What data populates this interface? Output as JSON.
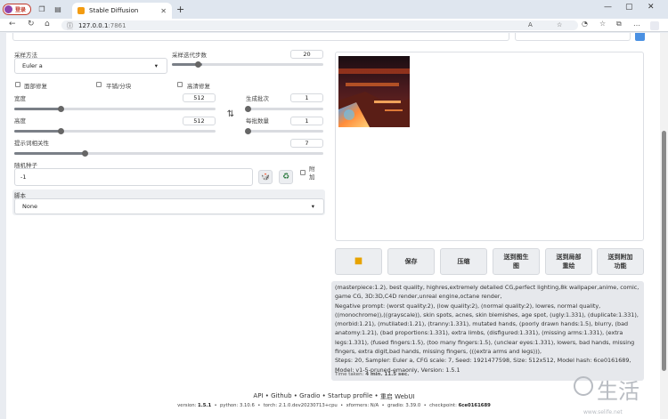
{
  "browser": {
    "profile_label": "登录",
    "tab_title": "Stable Diffusion",
    "url_host": "127.0.0.1",
    "url_port": ":7861"
  },
  "left": {
    "sampler": {
      "label": "采样方法",
      "value": "Euler a"
    },
    "steps": {
      "label": "采样迭代步数",
      "value": "20",
      "fraction": 0.2
    },
    "checks": {
      "face": "面部修复",
      "tiling": "平铺/分块",
      "hires": "高清修复"
    },
    "width": {
      "label": "宽度",
      "value": "512",
      "fraction": 0.23
    },
    "height": {
      "label": "高度",
      "value": "512",
      "fraction": 0.23
    },
    "batch_count": {
      "label": "生成批次",
      "value": "1",
      "fraction": 0.0
    },
    "batch_size": {
      "label": "每批数量",
      "value": "1",
      "fraction": 0.0
    },
    "cfg": {
      "label": "提示词相关性",
      "value": "7",
      "fraction": 0.23
    },
    "seed": {
      "label": "随机种子",
      "value": "-1",
      "extra": "附加"
    },
    "script": {
      "label": "脚本",
      "value": "None"
    }
  },
  "actions": {
    "save": "保存",
    "zip": "压缩",
    "send_img2img": "送到图生图",
    "send_inpaint": "送到局部重绘",
    "send_extras": "送到附加功能"
  },
  "generation_info": "(masterpiece:1.2), best quality, highres,extremely detailed CG,perfect lighting,8k wallpaper,anime, comic, game CG, 3D:3D,C4D render,unreal engine,octane render,\nNegative prompt: (worst quality:2), (low quality:2), (normal quality:2), lowres, normal quality, ((monochrome)),((grayscale)), skin spots, acnes, skin blemishes, age spot, (ugly:1.331), (duplicate:1.331), (morbid:1.21), (mutilated:1.21), (tranny:1.331), mutated hands, (poorly drawn hands:1.5), blurry, (bad anatomy:1.21), (bad proportions:1.331), extra limbs, (disfigured:1.331), (missing arms:1.331), (extra legs:1.331), (fused fingers:1.5), (too many fingers:1.5), (unclear eyes:1.331), lowers, bad hands, missing fingers, extra digit,bad hands, missing fingers, (((extra arms and legs))),\nSteps: 20, Sampler: Euler a, CFG scale: 7, Seed: 1921477598, Size: 512x512, Model hash: 6ce0161689, Model: v1-5-pruned-emaonly, Version: 1.5.1",
  "time_taken": {
    "label": "Time taken:",
    "value": "4 min. 11.5 sec."
  },
  "footer": {
    "links": [
      "API",
      "Github",
      "Gradio",
      "Startup profile",
      "重启 WebUI"
    ],
    "version_label": "version:",
    "version": "1.5.1",
    "python": "python: 3.10.6",
    "torch": "torch: 2.1.0.dev20230713+cpu",
    "xformers": "xformers: N/A",
    "gradio": "gradio: 3.39.0",
    "checkpoint_label": "checkpoint:",
    "checkpoint": "6ce0161689"
  },
  "watermark": {
    "text": "生活",
    "url": "www.selife.net"
  }
}
